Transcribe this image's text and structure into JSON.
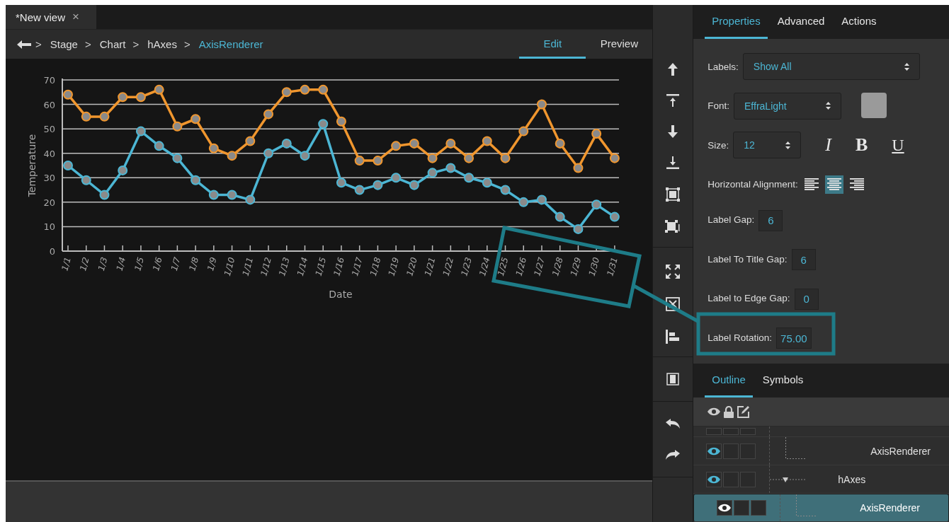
{
  "document_tabs": [
    {
      "label": "*New view",
      "close": "×"
    }
  ],
  "breadcrumb": [
    {
      "sep": ">",
      "label": "Stage",
      "selected": false
    },
    {
      "sep": ">",
      "label": "Chart",
      "selected": false
    },
    {
      "sep": ">",
      "label": "hAxes",
      "selected": false
    },
    {
      "sep": ">",
      "label": "AxisRenderer",
      "selected": true
    }
  ],
  "mode_tabs": [
    {
      "label": "Edit",
      "selected": true
    },
    {
      "label": "Preview",
      "selected": false
    }
  ],
  "chart": {
    "chart_data": {
      "type": "line",
      "xlabel": "Date",
      "ylabel": "Temperature",
      "categories": [
        "1/1",
        "1/2",
        "1/3",
        "1/4",
        "1/5",
        "1/6",
        "1/7",
        "1/8",
        "1/9",
        "1/10",
        "1/11",
        "1/12",
        "1/13",
        "1/14",
        "1/15",
        "1/16",
        "1/17",
        "1/18",
        "1/19",
        "1/20",
        "1/21",
        "1/22",
        "1/23",
        "1/24",
        "1/25",
        "1/26",
        "1/27",
        "1/28",
        "1/29",
        "1/30",
        "1/31"
      ],
      "grid": true,
      "ylim": [
        0,
        70
      ],
      "yticks": [
        0,
        10,
        20,
        30,
        40,
        50,
        60,
        70
      ],
      "series": [
        {
          "color": "#f0962e",
          "marker": "circle",
          "values": [
            64,
            55,
            55,
            63,
            63,
            66,
            51,
            54,
            42,
            39,
            45,
            56,
            65,
            66,
            66,
            53,
            37,
            37,
            43,
            44,
            38,
            44,
            38,
            45,
            38,
            49,
            60,
            44,
            34,
            48,
            38
          ]
        },
        {
          "color": "#4cb6d4",
          "marker": "circle",
          "values": [
            35,
            29,
            23,
            33,
            49,
            43,
            38,
            29,
            23,
            23,
            21,
            40,
            44,
            39,
            52,
            28,
            25,
            27,
            30,
            27,
            32,
            34,
            30,
            28,
            25,
            20,
            21,
            14,
            9,
            19,
            14
          ]
        }
      ]
    }
  },
  "property_tabs": [
    {
      "label": "Properties",
      "selected": true
    },
    {
      "label": "Advanced",
      "selected": false
    },
    {
      "label": "Actions",
      "selected": false
    }
  ],
  "properties": [
    {
      "kind": "select",
      "label": "Labels:",
      "value": "Show All"
    },
    {
      "kind": "font",
      "label": "Font:",
      "value": "EffraLight"
    },
    {
      "kind": "size",
      "label": "Size:",
      "value": "12",
      "styles": [
        {
          "label": "I",
          "selected": false
        },
        {
          "label": "B",
          "selected": false
        },
        {
          "label": "U",
          "selected": false
        }
      ]
    },
    {
      "kind": "align",
      "label": "Horizontal Alignment:",
      "options": [
        {
          "selected": false
        },
        {
          "selected": true
        },
        {
          "selected": false
        }
      ]
    },
    {
      "kind": "number",
      "label": "Label Gap:",
      "value": "6"
    },
    {
      "kind": "number",
      "label": "Label To Title Gap:",
      "value": "6"
    },
    {
      "kind": "number",
      "label": "Label to Edge Gap:",
      "value": "0"
    },
    {
      "kind": "number",
      "label": "Label Rotation:",
      "value": "75.00"
    }
  ],
  "outline_tabs": [
    {
      "label": "Outline",
      "selected": true
    },
    {
      "label": "Symbols",
      "selected": false
    }
  ],
  "outline": [
    {
      "label": "AxisRenderer",
      "visible": true,
      "selected": false
    },
    {
      "label": "hAxes",
      "visible": true,
      "selected": false,
      "expanded": true,
      "children": [
        {
          "label": "AxisRenderer",
          "visible": true,
          "selected": true
        }
      ]
    }
  ]
}
